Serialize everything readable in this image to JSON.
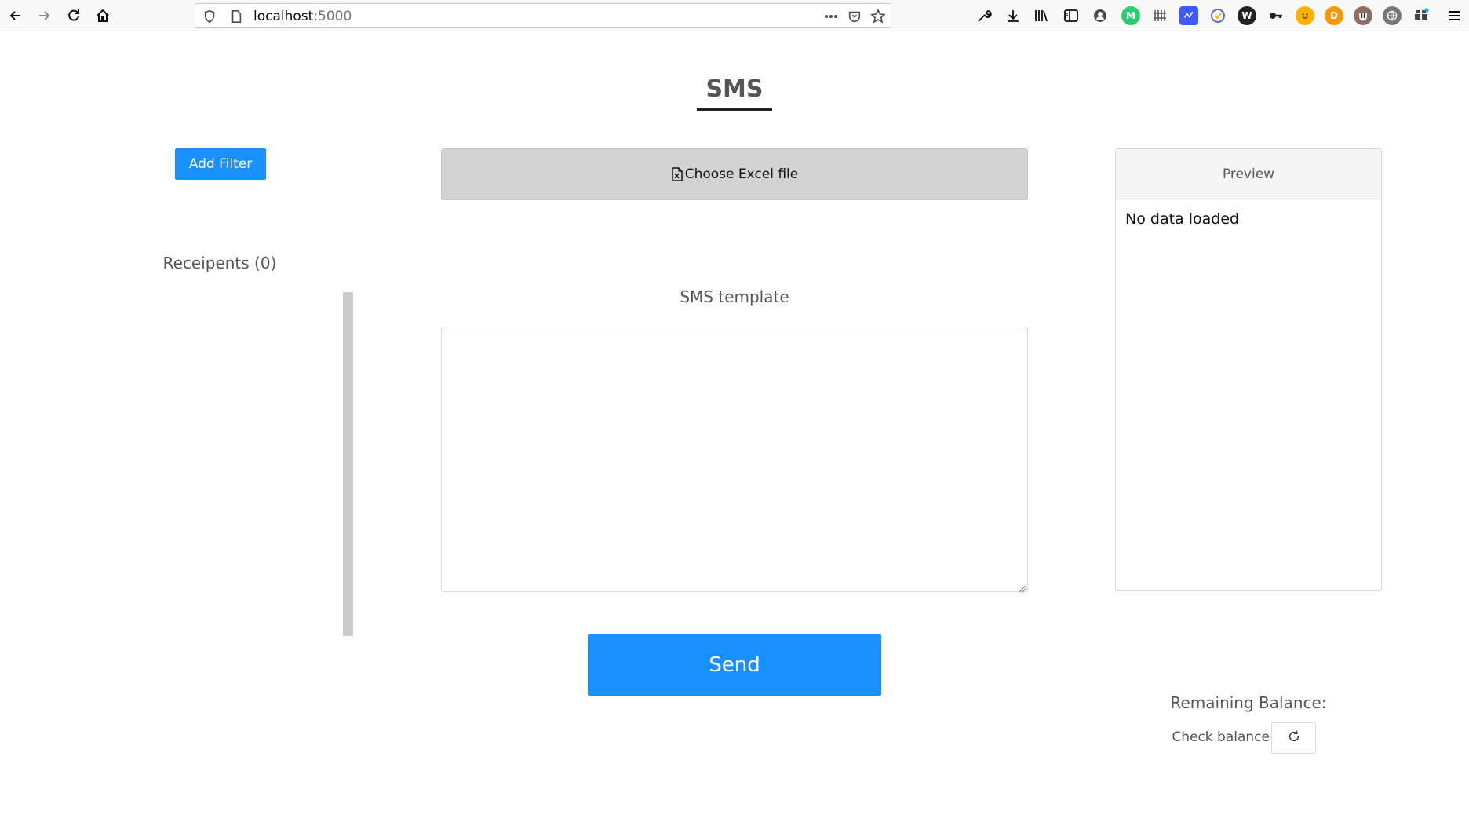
{
  "browser": {
    "url_host": "localhost",
    "url_port": ":5000",
    "nav_icons": [
      "back-icon",
      "forward-icon",
      "reload-icon",
      "home-icon"
    ],
    "url_icons": [
      "shield-icon",
      "page-icon",
      "more-icon",
      "pocket-icon",
      "star-icon"
    ],
    "toolbar_icons": [
      "wrench-icon",
      "download-icon",
      "library-icon",
      "sidebar-icon",
      "account-icon"
    ],
    "extensions": [
      {
        "name": "ext-m-icon",
        "letter": "M",
        "color": "#2ecc71"
      },
      {
        "name": "ext-grid-icon",
        "letter": "",
        "color": "#555555"
      },
      {
        "name": "ext-blue-icon",
        "letter": "",
        "color": "#3d5afe"
      },
      {
        "name": "ext-check-icon",
        "letter": "",
        "color": "#ffb300"
      },
      {
        "name": "ext-w-icon",
        "letter": "W",
        "color": "#222222"
      },
      {
        "name": "ext-key-icon",
        "letter": "",
        "color": "#222222"
      },
      {
        "name": "ext-smile-icon",
        "letter": "",
        "color": "#ff9800"
      },
      {
        "name": "ext-d-icon",
        "letter": "D",
        "color": "#ff9800"
      },
      {
        "name": "ext-badger-icon",
        "letter": "",
        "color": "#8d6e63"
      },
      {
        "name": "ext-globe-icon",
        "letter": "",
        "color": "#777777"
      },
      {
        "name": "ext-puzzle-icon",
        "letter": "",
        "color": "#444444"
      }
    ],
    "menu_icon": "hamburger-icon"
  },
  "page": {
    "title": "SMS",
    "add_filter": "Add Filter",
    "recipients_label": "Receipents (0)",
    "file_button": "Choose Excel file",
    "file_icon": "excel-file-icon",
    "template_label": "SMS template",
    "template_value": "",
    "send": "Send",
    "preview_title": "Preview",
    "preview_body": "No data loaded",
    "balance_label": "Remaining Balance:",
    "check_balance": "Check balance",
    "refresh_icon": "refresh-icon"
  },
  "colors": {
    "primary": "#1890ff",
    "file_button_bg": "#d3d3d3",
    "scrollbar": "#cccccc"
  }
}
